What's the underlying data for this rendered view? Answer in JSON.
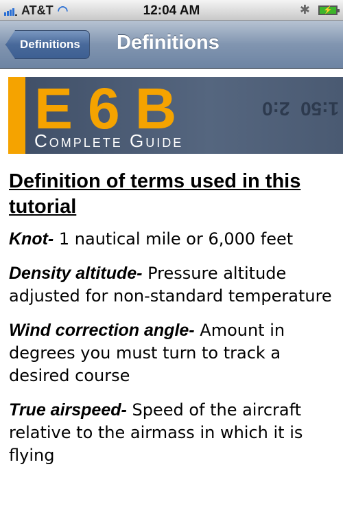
{
  "status_bar": {
    "carrier": "AT&T",
    "time": "12:04 AM",
    "icons": [
      "signal-icon",
      "wifi-icon",
      "bluetooth-icon",
      "battery-charging-icon"
    ]
  },
  "nav": {
    "back_label": "Definitions",
    "title": "Definitions"
  },
  "banner": {
    "logo_text": "E6B",
    "logo_subtitle": "Complete Guide",
    "accent": "#f5a300"
  },
  "content": {
    "heading": "Definition of terms used in this tutorial",
    "terms": [
      {
        "term": "Knot-",
        "definition": " 1 nautical mile or 6,000 feet"
      },
      {
        "term": "Density altitude-",
        "definition": " Pressure altitude adjusted for non-standard temperature"
      },
      {
        "term": "Wind correction angle-",
        "definition": " Amount in degrees you must turn to track a desired course"
      },
      {
        "term": "True airspeed-",
        "definition": " Speed of the aircraft relative to the airmass in which it is flying"
      }
    ]
  }
}
